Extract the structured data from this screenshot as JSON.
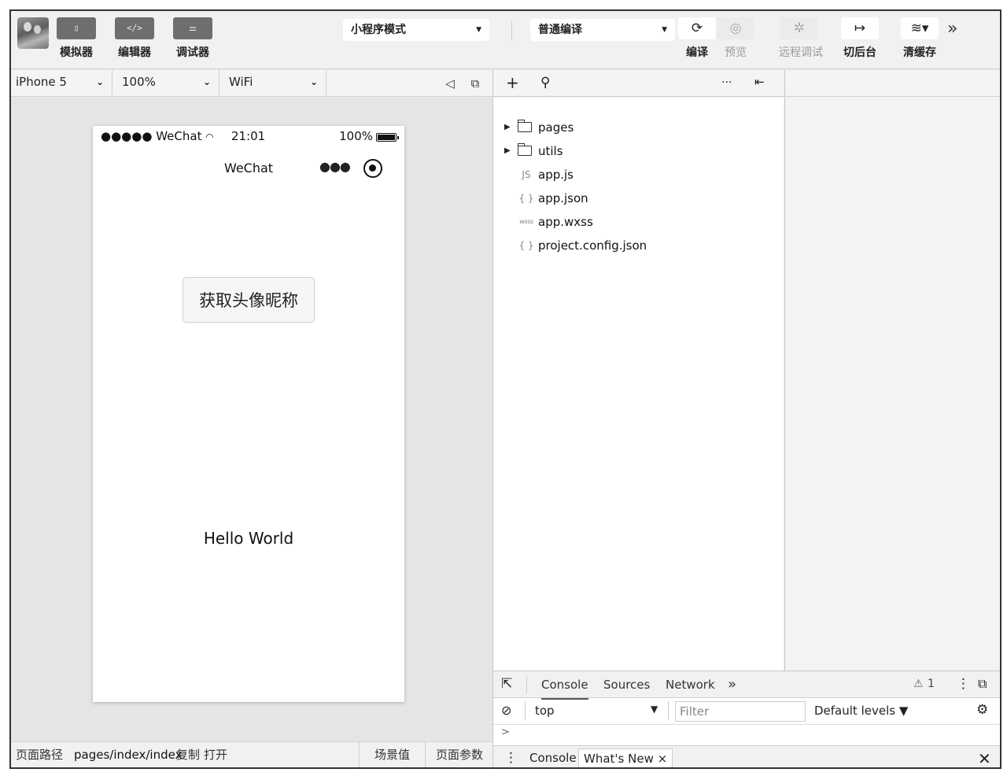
{
  "toolbar": {
    "simulator_label": "模拟器",
    "simulator_icon": "phone-icon",
    "editor_label": "编辑器",
    "editor_icon": "code-icon",
    "debugger_label": "调试器",
    "debugger_icon": "sliders-icon",
    "mode_select": "小程序模式",
    "compile_select": "普通编译",
    "compile_label": "编译",
    "preview_label": "预览",
    "remote_debug_label": "远程调试",
    "background_label": "切后台",
    "clear_cache_label": "清缓存",
    "more_icon": "double-chevron-right-icon"
  },
  "device_bar": {
    "device": "iPhone 5",
    "zoom": "100%",
    "network": "WiFi"
  },
  "phone": {
    "carrier": "●●●●● WeChat",
    "time": "21:01",
    "battery": "100%",
    "nav_title": "WeChat",
    "button_label": "获取头像昵称",
    "hello_text": "Hello World"
  },
  "path_bar": {
    "path_label": "页面路径",
    "path_value": "pages/index/index",
    "copy_label": "复制",
    "open_label": "打开",
    "scene_label": "场景值",
    "params_label": "页面参数"
  },
  "explorer": {
    "items": [
      {
        "type": "folder",
        "name": "pages"
      },
      {
        "type": "folder",
        "name": "utils"
      },
      {
        "type": "JS",
        "name": "app.js"
      },
      {
        "type": "{ }",
        "name": "app.json"
      },
      {
        "type": "wxss",
        "name": "app.wxss"
      },
      {
        "type": "{ }",
        "name": "project.config.json"
      }
    ]
  },
  "devtools": {
    "tabs": [
      "Console",
      "Sources",
      "Network"
    ],
    "warning_count": "1",
    "context": "top",
    "filter_placeholder": "Filter",
    "levels": "Default levels ▼",
    "prompt": ">",
    "drawer_tabs": [
      "Console",
      "What's New"
    ]
  }
}
